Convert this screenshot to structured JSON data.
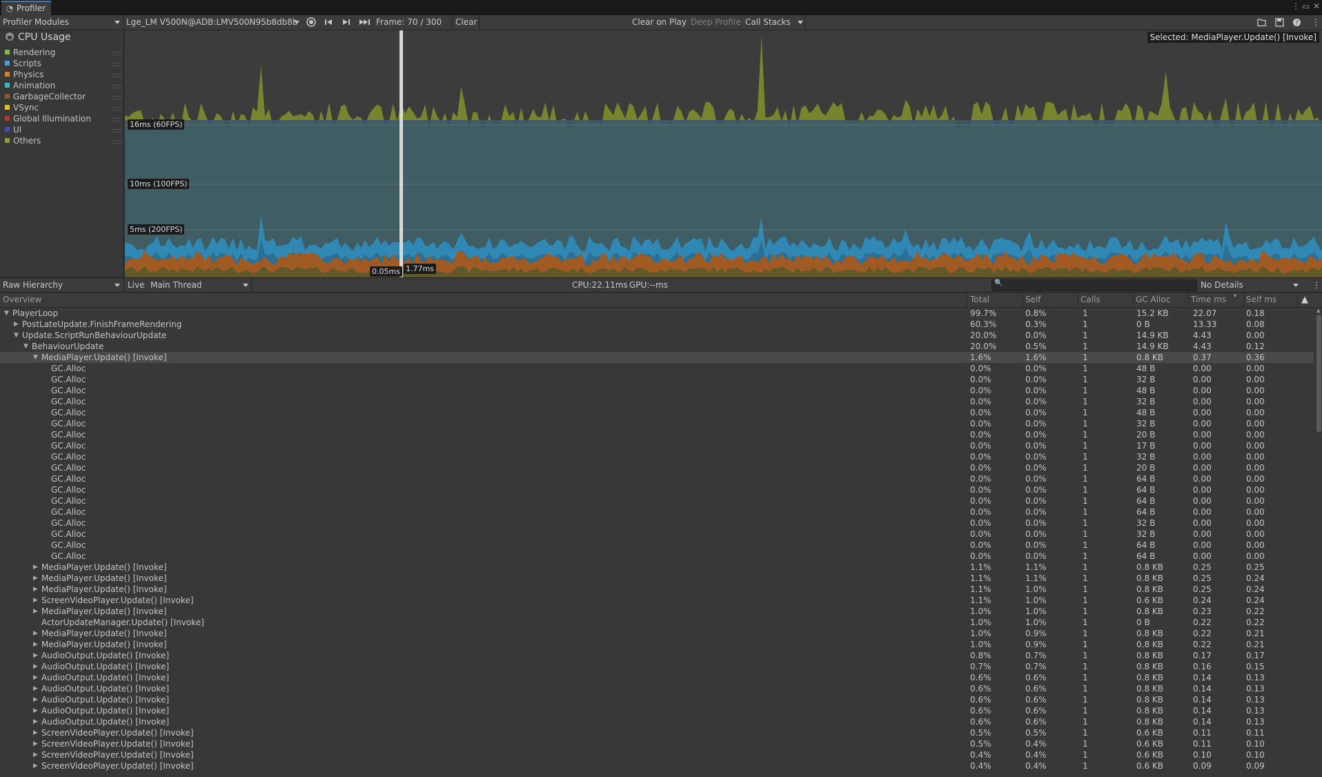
{
  "window": {
    "title": "Profiler",
    "controls": [
      "⋮",
      "▭",
      "✕"
    ]
  },
  "toolbar": {
    "modules_label": "Profiler Modules",
    "target_label": "Lge_LM V500N@ADB:LMV500N95b8db8b",
    "frame_label": "Frame: 70 / 300",
    "clear_label": "Clear",
    "clear_on_play_label": "Clear on Play",
    "deep_profile_label": "Deep Profile",
    "call_stacks_label": "Call Stacks"
  },
  "module": {
    "title": "CPU Usage",
    "legend": [
      {
        "label": "Rendering",
        "color": "#7fbf3f"
      },
      {
        "label": "Scripts",
        "color": "#4aa1d6"
      },
      {
        "label": "Physics",
        "color": "#e07b20"
      },
      {
        "label": "Animation",
        "color": "#38b8c2"
      },
      {
        "label": "GarbageCollector",
        "color": "#8a5a2a"
      },
      {
        "label": "VSync",
        "color": "#e2c21e"
      },
      {
        "label": "Global Illumination",
        "color": "#b33a2c"
      },
      {
        "label": "UI",
        "color": "#3f4fa8"
      },
      {
        "label": "Others",
        "color": "#8f9c2e"
      }
    ]
  },
  "chart": {
    "fps_60": "16ms (60FPS)",
    "fps_100": "10ms (100FPS)",
    "fps_200": "5ms (200FPS)",
    "cursor_low": "0.05ms",
    "cursor_high": "1.77ms",
    "selected_label": "Selected: MediaPlayer.Update() [Invoke]"
  },
  "details": {
    "view_mode": "Raw Hierarchy",
    "live_label": "Live",
    "thread_label": "Main Thread",
    "cpu_label": "CPU:22.11ms",
    "gpu_label": "GPU:--ms",
    "search_placeholder": "",
    "details_mode": "No Details"
  },
  "table": {
    "columns": [
      "Overview",
      "Total",
      "Self",
      "Calls",
      "GC Alloc",
      "Time ms",
      "Self ms"
    ],
    "rows": [
      {
        "name": "PlayerLoop",
        "depth": 0,
        "expand": "open",
        "total": "99.7%",
        "self": "0.8%",
        "calls": "1",
        "gc": "15.2 KB",
        "time": "22.07",
        "selfms": "0.18"
      },
      {
        "name": "PostLateUpdate.FinishFrameRendering",
        "depth": 1,
        "expand": "closed",
        "total": "60.3%",
        "self": "0.3%",
        "calls": "1",
        "gc": "0 B",
        "time": "13.33",
        "selfms": "0.08"
      },
      {
        "name": "Update.ScriptRunBehaviourUpdate",
        "depth": 1,
        "expand": "open",
        "total": "20.0%",
        "self": "0.0%",
        "calls": "1",
        "gc": "14.9 KB",
        "time": "4.43",
        "selfms": "0.00"
      },
      {
        "name": "BehaviourUpdate",
        "depth": 2,
        "expand": "open",
        "total": "20.0%",
        "self": "0.5%",
        "calls": "1",
        "gc": "14.9 KB",
        "time": "4.43",
        "selfms": "0.12"
      },
      {
        "name": "MediaPlayer.Update() [Invoke]",
        "depth": 3,
        "expand": "open",
        "selected": true,
        "total": "1.6%",
        "self": "1.6%",
        "calls": "1",
        "gc": "0.8 KB",
        "time": "0.37",
        "selfms": "0.36"
      },
      {
        "name": "GC.Alloc",
        "depth": 4,
        "expand": "none",
        "total": "0.0%",
        "self": "0.0%",
        "calls": "1",
        "gc": "48 B",
        "time": "0.00",
        "selfms": "0.00"
      },
      {
        "name": "GC.Alloc",
        "depth": 4,
        "expand": "none",
        "total": "0.0%",
        "self": "0.0%",
        "calls": "1",
        "gc": "32 B",
        "time": "0.00",
        "selfms": "0.00"
      },
      {
        "name": "GC.Alloc",
        "depth": 4,
        "expand": "none",
        "total": "0.0%",
        "self": "0.0%",
        "calls": "1",
        "gc": "48 B",
        "time": "0.00",
        "selfms": "0.00"
      },
      {
        "name": "GC.Alloc",
        "depth": 4,
        "expand": "none",
        "total": "0.0%",
        "self": "0.0%",
        "calls": "1",
        "gc": "32 B",
        "time": "0.00",
        "selfms": "0.00"
      },
      {
        "name": "GC.Alloc",
        "depth": 4,
        "expand": "none",
        "total": "0.0%",
        "self": "0.0%",
        "calls": "1",
        "gc": "48 B",
        "time": "0.00",
        "selfms": "0.00"
      },
      {
        "name": "GC.Alloc",
        "depth": 4,
        "expand": "none",
        "total": "0.0%",
        "self": "0.0%",
        "calls": "1",
        "gc": "32 B",
        "time": "0.00",
        "selfms": "0.00"
      },
      {
        "name": "GC.Alloc",
        "depth": 4,
        "expand": "none",
        "total": "0.0%",
        "self": "0.0%",
        "calls": "1",
        "gc": "20 B",
        "time": "0.00",
        "selfms": "0.00"
      },
      {
        "name": "GC.Alloc",
        "depth": 4,
        "expand": "none",
        "total": "0.0%",
        "self": "0.0%",
        "calls": "1",
        "gc": "17 B",
        "time": "0.00",
        "selfms": "0.00"
      },
      {
        "name": "GC.Alloc",
        "depth": 4,
        "expand": "none",
        "total": "0.0%",
        "self": "0.0%",
        "calls": "1",
        "gc": "32 B",
        "time": "0.00",
        "selfms": "0.00"
      },
      {
        "name": "GC.Alloc",
        "depth": 4,
        "expand": "none",
        "total": "0.0%",
        "self": "0.0%",
        "calls": "1",
        "gc": "20 B",
        "time": "0.00",
        "selfms": "0.00"
      },
      {
        "name": "GC.Alloc",
        "depth": 4,
        "expand": "none",
        "total": "0.0%",
        "self": "0.0%",
        "calls": "1",
        "gc": "64 B",
        "time": "0.00",
        "selfms": "0.00"
      },
      {
        "name": "GC.Alloc",
        "depth": 4,
        "expand": "none",
        "total": "0.0%",
        "self": "0.0%",
        "calls": "1",
        "gc": "64 B",
        "time": "0.00",
        "selfms": "0.00"
      },
      {
        "name": "GC.Alloc",
        "depth": 4,
        "expand": "none",
        "total": "0.0%",
        "self": "0.0%",
        "calls": "1",
        "gc": "64 B",
        "time": "0.00",
        "selfms": "0.00"
      },
      {
        "name": "GC.Alloc",
        "depth": 4,
        "expand": "none",
        "total": "0.0%",
        "self": "0.0%",
        "calls": "1",
        "gc": "64 B",
        "time": "0.00",
        "selfms": "0.00"
      },
      {
        "name": "GC.Alloc",
        "depth": 4,
        "expand": "none",
        "total": "0.0%",
        "self": "0.0%",
        "calls": "1",
        "gc": "32 B",
        "time": "0.00",
        "selfms": "0.00"
      },
      {
        "name": "GC.Alloc",
        "depth": 4,
        "expand": "none",
        "total": "0.0%",
        "self": "0.0%",
        "calls": "1",
        "gc": "32 B",
        "time": "0.00",
        "selfms": "0.00"
      },
      {
        "name": "GC.Alloc",
        "depth": 4,
        "expand": "none",
        "total": "0.0%",
        "self": "0.0%",
        "calls": "1",
        "gc": "64 B",
        "time": "0.00",
        "selfms": "0.00"
      },
      {
        "name": "GC.Alloc",
        "depth": 4,
        "expand": "none",
        "total": "0.0%",
        "self": "0.0%",
        "calls": "1",
        "gc": "64 B",
        "time": "0.00",
        "selfms": "0.00"
      },
      {
        "name": "MediaPlayer.Update() [Invoke]",
        "depth": 3,
        "expand": "closed",
        "total": "1.1%",
        "self": "1.1%",
        "calls": "1",
        "gc": "0.8 KB",
        "time": "0.25",
        "selfms": "0.25"
      },
      {
        "name": "MediaPlayer.Update() [Invoke]",
        "depth": 3,
        "expand": "closed",
        "total": "1.1%",
        "self": "1.1%",
        "calls": "1",
        "gc": "0.8 KB",
        "time": "0.25",
        "selfms": "0.24"
      },
      {
        "name": "MediaPlayer.Update() [Invoke]",
        "depth": 3,
        "expand": "closed",
        "total": "1.1%",
        "self": "1.0%",
        "calls": "1",
        "gc": "0.8 KB",
        "time": "0.25",
        "selfms": "0.24"
      },
      {
        "name": "ScreenVideoPlayer.Update() [Invoke]",
        "depth": 3,
        "expand": "closed",
        "total": "1.1%",
        "self": "1.0%",
        "calls": "1",
        "gc": "0.6 KB",
        "time": "0.24",
        "selfms": "0.24"
      },
      {
        "name": "MediaPlayer.Update() [Invoke]",
        "depth": 3,
        "expand": "closed",
        "total": "1.0%",
        "self": "1.0%",
        "calls": "1",
        "gc": "0.8 KB",
        "time": "0.23",
        "selfms": "0.22"
      },
      {
        "name": "ActorUpdateManager.Update() [Invoke]",
        "depth": 3,
        "expand": "none",
        "total": "1.0%",
        "self": "1.0%",
        "calls": "1",
        "gc": "0 B",
        "time": "0.22",
        "selfms": "0.22"
      },
      {
        "name": "MediaPlayer.Update() [Invoke]",
        "depth": 3,
        "expand": "closed",
        "total": "1.0%",
        "self": "0.9%",
        "calls": "1",
        "gc": "0.8 KB",
        "time": "0.22",
        "selfms": "0.21"
      },
      {
        "name": "MediaPlayer.Update() [Invoke]",
        "depth": 3,
        "expand": "closed",
        "total": "1.0%",
        "self": "0.9%",
        "calls": "1",
        "gc": "0.8 KB",
        "time": "0.22",
        "selfms": "0.21"
      },
      {
        "name": "AudioOutput.Update() [Invoke]",
        "depth": 3,
        "expand": "closed",
        "total": "0.8%",
        "self": "0.7%",
        "calls": "1",
        "gc": "0.8 KB",
        "time": "0.17",
        "selfms": "0.17"
      },
      {
        "name": "AudioOutput.Update() [Invoke]",
        "depth": 3,
        "expand": "closed",
        "total": "0.7%",
        "self": "0.7%",
        "calls": "1",
        "gc": "0.8 KB",
        "time": "0.16",
        "selfms": "0.15"
      },
      {
        "name": "AudioOutput.Update() [Invoke]",
        "depth": 3,
        "expand": "closed",
        "total": "0.6%",
        "self": "0.6%",
        "calls": "1",
        "gc": "0.8 KB",
        "time": "0.14",
        "selfms": "0.13"
      },
      {
        "name": "AudioOutput.Update() [Invoke]",
        "depth": 3,
        "expand": "closed",
        "total": "0.6%",
        "self": "0.6%",
        "calls": "1",
        "gc": "0.8 KB",
        "time": "0.14",
        "selfms": "0.13"
      },
      {
        "name": "AudioOutput.Update() [Invoke]",
        "depth": 3,
        "expand": "closed",
        "total": "0.6%",
        "self": "0.6%",
        "calls": "1",
        "gc": "0.8 KB",
        "time": "0.14",
        "selfms": "0.13"
      },
      {
        "name": "AudioOutput.Update() [Invoke]",
        "depth": 3,
        "expand": "closed",
        "total": "0.6%",
        "self": "0.6%",
        "calls": "1",
        "gc": "0.8 KB",
        "time": "0.14",
        "selfms": "0.13"
      },
      {
        "name": "AudioOutput.Update() [Invoke]",
        "depth": 3,
        "expand": "closed",
        "total": "0.6%",
        "self": "0.6%",
        "calls": "1",
        "gc": "0.8 KB",
        "time": "0.14",
        "selfms": "0.13"
      },
      {
        "name": "ScreenVideoPlayer.Update() [Invoke]",
        "depth": 3,
        "expand": "closed",
        "total": "0.5%",
        "self": "0.5%",
        "calls": "1",
        "gc": "0.6 KB",
        "time": "0.11",
        "selfms": "0.11"
      },
      {
        "name": "ScreenVideoPlayer.Update() [Invoke]",
        "depth": 3,
        "expand": "closed",
        "total": "0.5%",
        "self": "0.4%",
        "calls": "1",
        "gc": "0.6 KB",
        "time": "0.11",
        "selfms": "0.10"
      },
      {
        "name": "ScreenVideoPlayer.Update() [Invoke]",
        "depth": 3,
        "expand": "closed",
        "total": "0.4%",
        "self": "0.4%",
        "calls": "1",
        "gc": "0.6 KB",
        "time": "0.10",
        "selfms": "0.10"
      },
      {
        "name": "ScreenVideoPlayer.Update() [Invoke]",
        "depth": 3,
        "expand": "closed",
        "total": "0.4%",
        "self": "0.4%",
        "calls": "1",
        "gc": "0.6 KB",
        "time": "0.09",
        "selfms": "0.09"
      }
    ]
  }
}
